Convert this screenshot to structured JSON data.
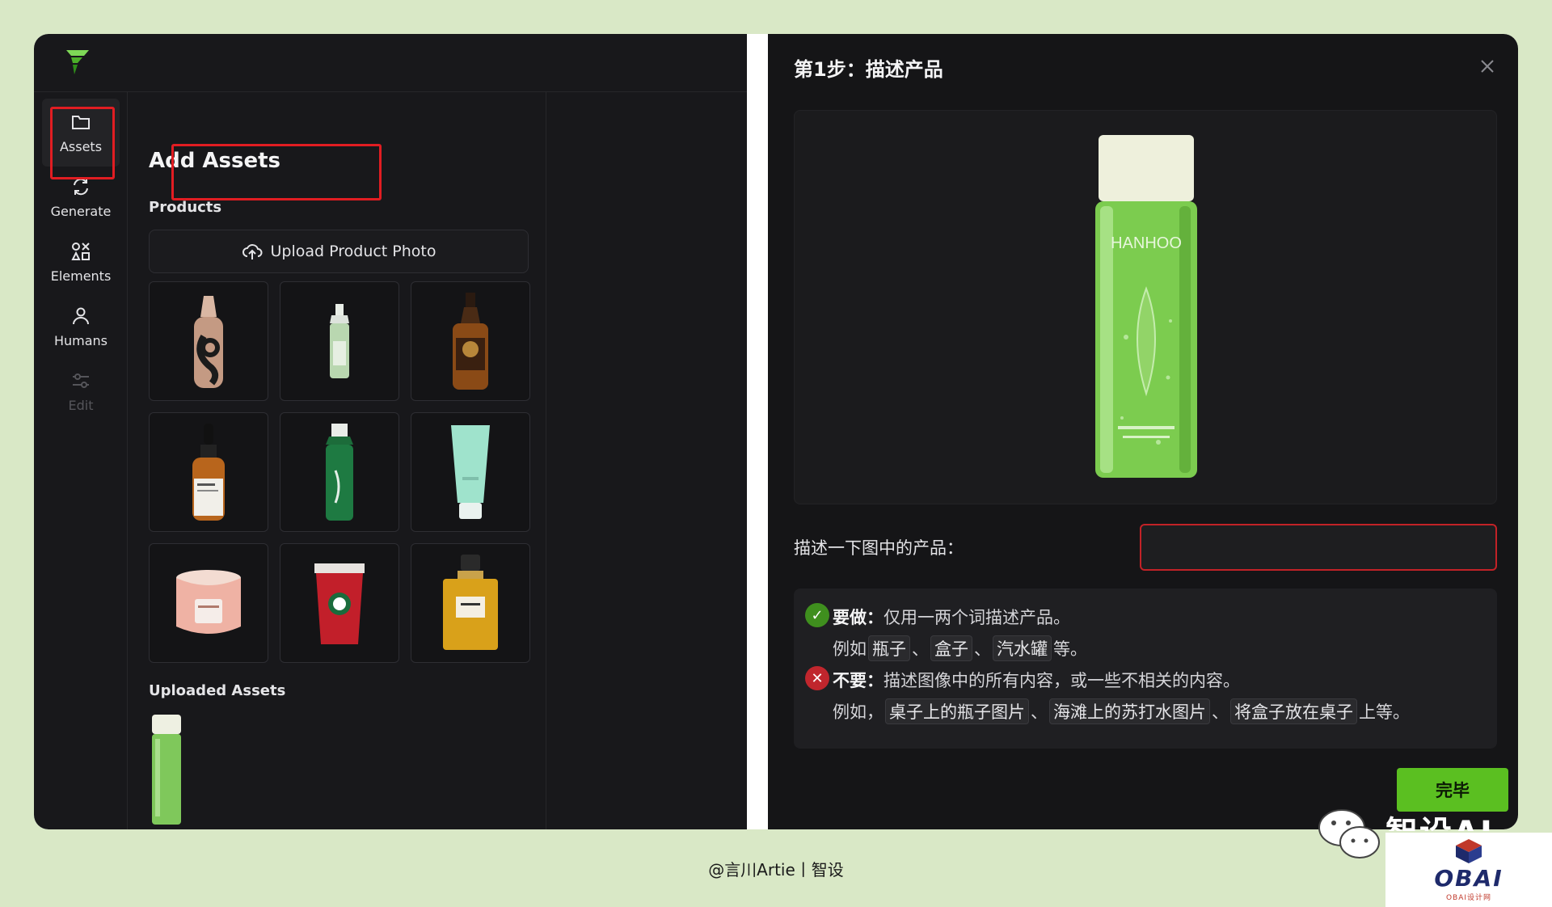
{
  "nav": {
    "items": [
      {
        "label": "Assets",
        "icon": "folder-icon",
        "active": true
      },
      {
        "label": "Generate",
        "icon": "refresh-icon"
      },
      {
        "label": "Elements",
        "icon": "shapes-icon"
      },
      {
        "label": "Humans",
        "icon": "person-icon"
      },
      {
        "label": "Edit",
        "icon": "sliders-icon",
        "disabled": true
      }
    ]
  },
  "assets": {
    "title": "Add Assets",
    "products_label": "Products",
    "upload_label": "Upload Product Photo",
    "products": [
      {
        "name": "foundation bottle",
        "icon": "foundation-bottle-icon"
      },
      {
        "name": "small spray bottle",
        "icon": "spray-bottle-icon"
      },
      {
        "name": "whiskey bottle",
        "icon": "whiskey-bottle-icon"
      },
      {
        "name": "serum dropper",
        "icon": "dropper-bottle-icon"
      },
      {
        "name": "green bottle",
        "icon": "green-bottle-icon"
      },
      {
        "name": "mint tube",
        "icon": "cream-tube-icon"
      },
      {
        "name": "candle jar",
        "icon": "candle-icon"
      },
      {
        "name": "red cup",
        "icon": "coffee-cup-icon"
      },
      {
        "name": "perfume bottle",
        "icon": "perfume-bottle-icon"
      }
    ],
    "uploaded_label": "Uploaded Assets"
  },
  "dialog": {
    "title": "第1步：描述产品",
    "product_brand": "HANHOO",
    "describe_label": "描述一下图中的产品：",
    "describe_value": "",
    "do_label": "要做：",
    "do_text": "仅用一两个词描述产品。",
    "do_example_prefix": "例如",
    "do_examples": [
      "瓶子",
      "盒子",
      "汽水罐"
    ],
    "sep": "、",
    "do_suffix": "等。",
    "dont_label": "不要：",
    "dont_text": "描述图像中的所有内容，或一些不相关的内容。",
    "dont_example_prefix": "例如，",
    "dont_examples": [
      "桌子上的瓶子图片",
      "海滩上的苏打水图片",
      "将盒子放在桌子"
    ],
    "dont_suffix": "上等。",
    "done_label": "完毕"
  },
  "caption": "@言川Artie丨智设",
  "watermark": {
    "text": "智设AI",
    "badge": "OBAI",
    "badge_sub": "OBAI设计网"
  },
  "colors": {
    "accent": "#5bbf21",
    "highlight": "#e11d22",
    "do": "#3f8f1e",
    "dont": "#c0262d"
  }
}
